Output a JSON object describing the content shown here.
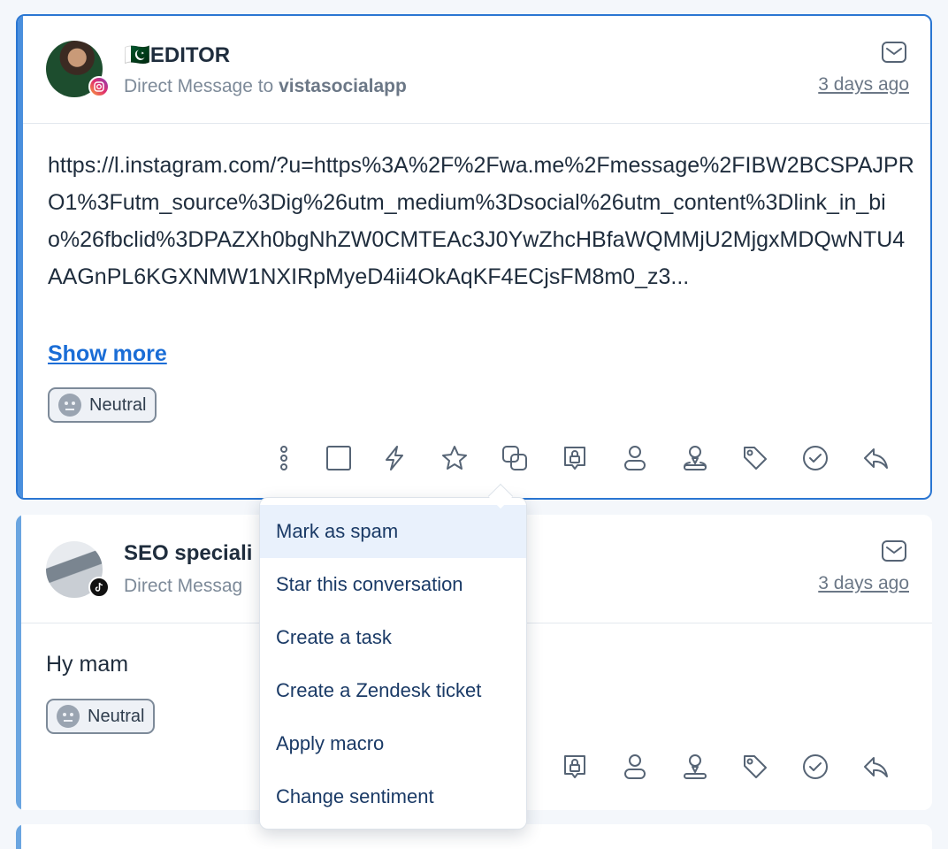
{
  "conversations": [
    {
      "author": "🇵🇰EDITOR",
      "channel_prefix": "Direct Message to ",
      "account": "vistasocialapp",
      "time": "3 days ago",
      "network": "instagram",
      "message": "https://l.instagram.com/?u=https%3A%2F%2Fwa.me%2Fmessage%2FIBW2BCSPAJPRO1%3Futm_source%3Dig%26utm_medium%3Dsocial%26utm_content%3Dlink_in_bio%26fbclid%3DPAZXh0bgNhZW0CMTEAc3J0YwZhcHBfaWQMMjU2MjgxMDQwNTU4AAGnPL6KGXNMW1NXIRpMyeD4ii4OkAqKF4ECjsFM8m0_z3...",
      "show_more": "Show more",
      "sentiment": "Neutral"
    },
    {
      "author": "SEO speciali",
      "channel_prefix": "Direct Messag",
      "time": "3 days ago",
      "network": "tiktok",
      "message": "Hy mam",
      "sentiment": "Neutral"
    }
  ],
  "context_menu": {
    "items": [
      "Mark as spam",
      "Star this conversation",
      "Create a task",
      "Create a Zendesk ticket",
      "Apply macro",
      "Change sentiment"
    ]
  },
  "colors": {
    "accent": "#2a76d2",
    "link": "#1a6dd6",
    "menu_text": "#1a3a66",
    "menu_highlight": "#e9f1fc"
  },
  "icons": [
    "more-vertical-icon",
    "checkbox-icon",
    "lightning-icon",
    "star-icon",
    "merge-icon",
    "lock-chat-icon",
    "user-icon",
    "assign-user-icon",
    "tag-icon",
    "check-circle-icon",
    "reply-icon",
    "mail-icon"
  ]
}
